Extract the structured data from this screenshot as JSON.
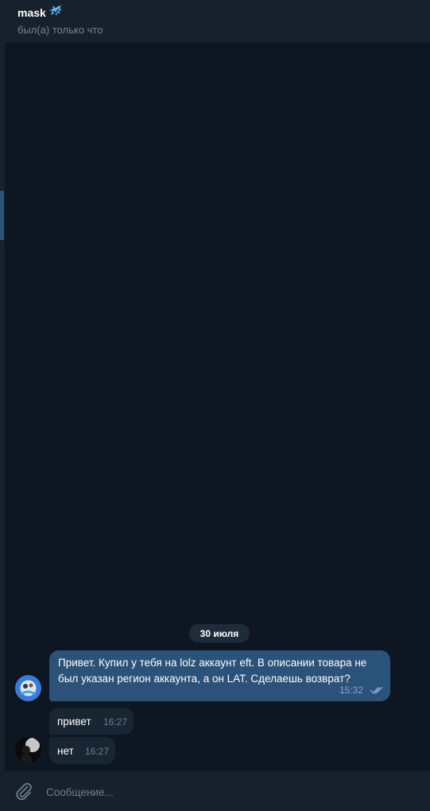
{
  "header": {
    "title": "mask",
    "status": "был(а) только что"
  },
  "date_separator": "30 июля",
  "messages": [
    {
      "direction": "out",
      "text": "Привет. Купил у тебя на lolz аккаунт eft. В описании товара не был указан регион аккаунта, а он LAT. Сделаешь возврат?",
      "time": "15:32",
      "read": true
    },
    {
      "direction": "in",
      "text": "привет",
      "time": "16:27"
    },
    {
      "direction": "in",
      "text": "нет",
      "time": "16:27"
    }
  ],
  "composer": {
    "placeholder": "Сообщение..."
  },
  "colors": {
    "background": "#0e1621",
    "panel": "#17212b",
    "outgoing_bubble": "#2b5278",
    "incoming_bubble": "#182533",
    "accent": "#5eb5f7"
  },
  "icons": [
    "verified-badge-icon",
    "double-check-icon",
    "paperclip-icon"
  ]
}
